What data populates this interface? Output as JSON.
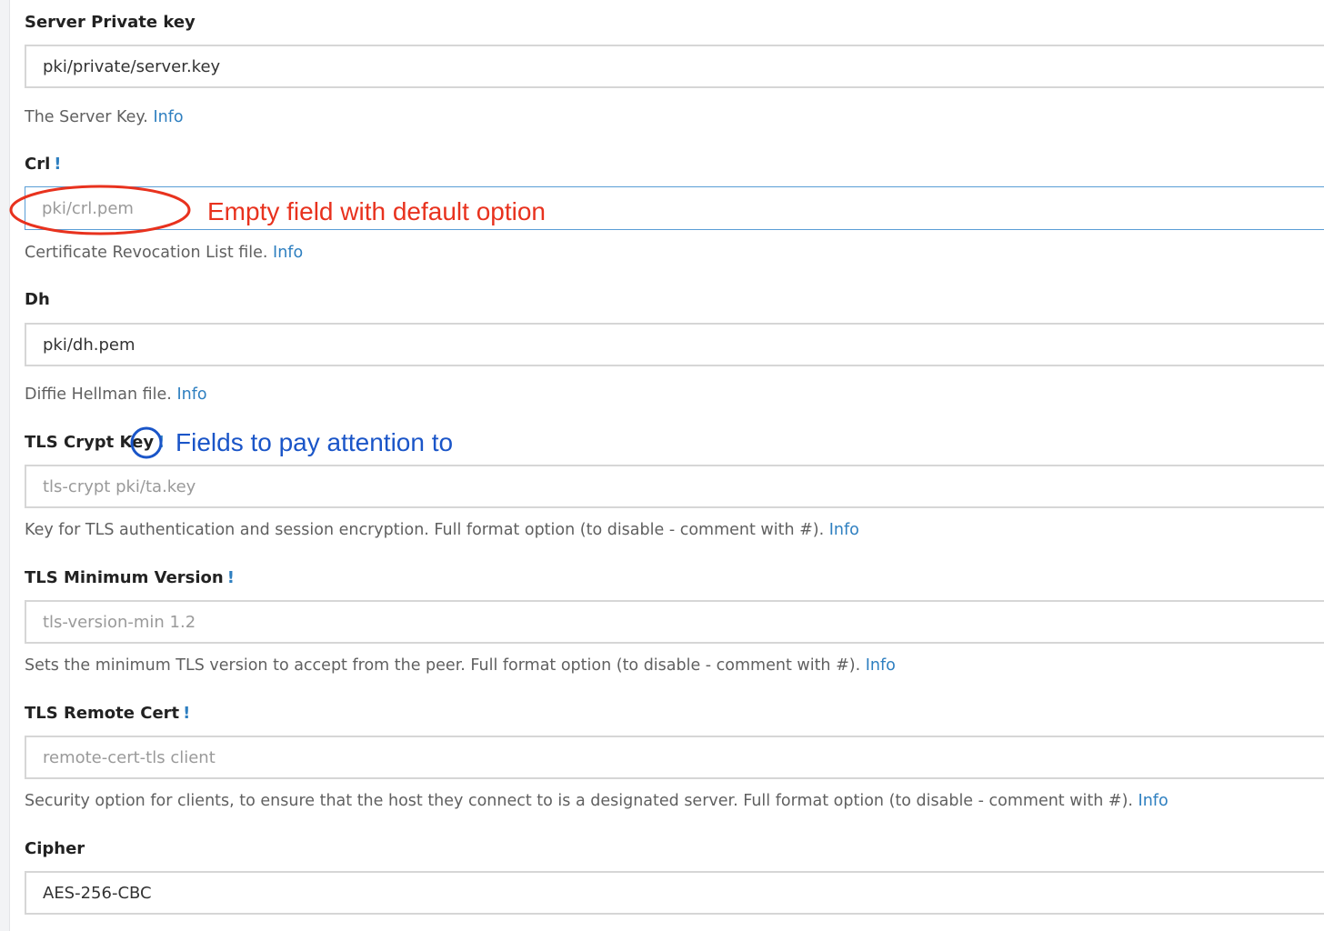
{
  "colors": {
    "label": "#222222",
    "help_text": "#606060",
    "link": "#2e7fc0",
    "input_border": "#d6d6d6",
    "placeholder": "#9a9a9a",
    "annotation_red": "#e8321e",
    "annotation_blue": "#1a55c8"
  },
  "fields": {
    "server_private_key": {
      "label": "Server Private key",
      "value": "pki/private/server.key",
      "help": "The Server Key.",
      "info": "Info"
    },
    "crl": {
      "label": "Crl",
      "attention": "!",
      "placeholder": "pki/crl.pem",
      "help": "Certificate Revocation List file.",
      "info": "Info"
    },
    "dh": {
      "label": "Dh",
      "value": "pki/dh.pem",
      "help": "Diffie Hellman file.",
      "info": "Info"
    },
    "tls_crypt_key": {
      "label": "TLS Crypt Key",
      "attention": "!",
      "placeholder": "tls-crypt pki/ta.key",
      "help": "Key for TLS authentication and session encryption. Full format option (to disable - comment with #).",
      "info": "Info"
    },
    "tls_minimum_version": {
      "label": "TLS Minimum Version",
      "attention": "!",
      "placeholder": "tls-version-min 1.2",
      "help": "Sets the minimum TLS version to accept from the peer. Full format option (to disable - comment with #).",
      "info": "Info"
    },
    "tls_remote_cert": {
      "label": "TLS Remote Cert",
      "attention": "!",
      "placeholder": "remote-cert-tls client",
      "help": "Security option for clients, to ensure that the host they connect to is a designated server. Full format option (to disable - comment with #).",
      "info": "Info"
    },
    "cipher": {
      "label": "Cipher",
      "value": "AES-256-CBC"
    }
  },
  "annotations": {
    "empty_field": "Empty field with default option",
    "attention_fields": "Fields to pay attention to"
  }
}
